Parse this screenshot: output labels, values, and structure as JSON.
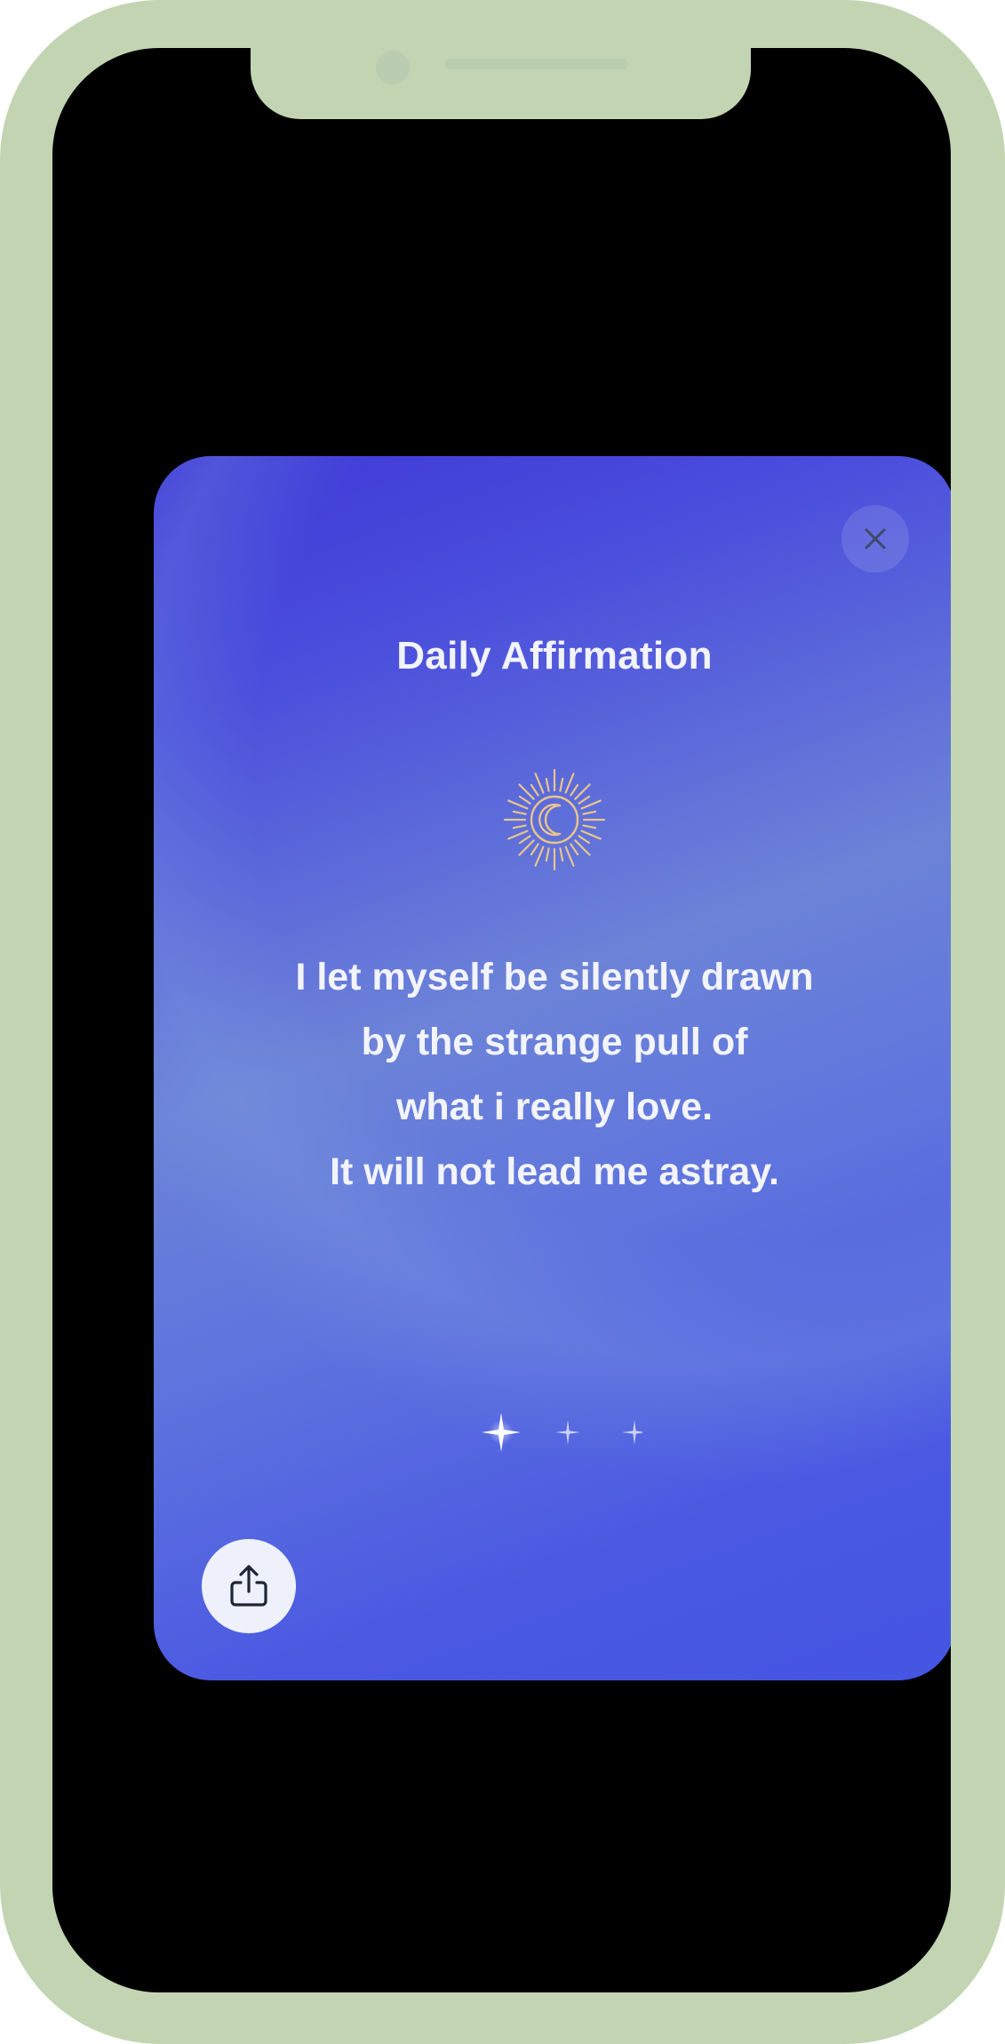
{
  "card": {
    "title": "Daily Affirmation",
    "affirmation_lines": [
      "I let myself be silently drawn",
      "by the strange pull of",
      "what i really love.",
      "It will not lead me astray."
    ]
  },
  "icons": {
    "close": "close-icon",
    "emblem": "sun-moon-icon",
    "sparkles": "sparkle-icon",
    "share": "share-icon"
  },
  "colors": {
    "frame": "#c3d4b2",
    "card_start": "#3d38d7",
    "card_end": "#4456e2",
    "emblem": "#e8c58a",
    "text": "#f3f4fb"
  }
}
